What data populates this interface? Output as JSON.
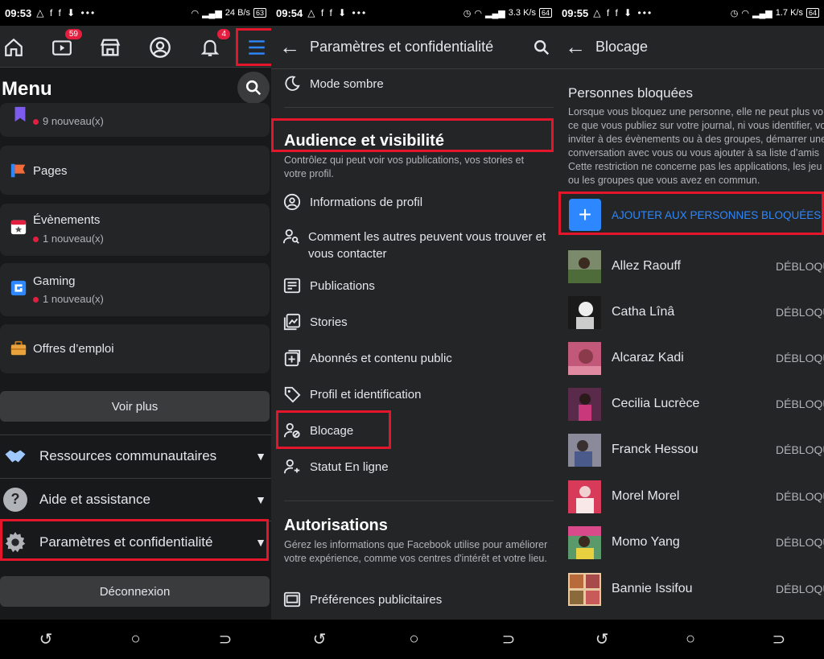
{
  "colors": {
    "highlight": "#e3162c",
    "accent": "#2d88ff",
    "badge": "#e41e3f",
    "bg": "#242526"
  },
  "status_bars": [
    {
      "time": "09:53",
      "left_icons": "△ f f ⬇ •••",
      "right_text": "24 B/s",
      "battery": "63"
    },
    {
      "time": "09:54",
      "left_icons": "△ f f ⬇ •••",
      "right_text": "3.3 K/s",
      "battery": "64"
    },
    {
      "time": "09:55",
      "left_icons": "△ f f ⬇ •••",
      "right_text": "1.7 K/s",
      "battery": "64"
    }
  ],
  "panel1": {
    "top_nav": {
      "watch_badge": "59",
      "notifications_badge": "4"
    },
    "title": "Menu",
    "shortcuts": [
      {
        "name": "",
        "new": "9 nouveau(x)",
        "icon": "bookmark-icon",
        "color": "#7e5bef"
      },
      {
        "name": "Pages",
        "new": "",
        "icon": "flag-icon",
        "color": "#f26b3a"
      },
      {
        "name": "Évènements",
        "new": "1 nouveau(x)",
        "icon": "calendar-icon",
        "color": "#e41e3f"
      },
      {
        "name": "Gaming",
        "new": "1 nouveau(x)",
        "icon": "gaming-icon",
        "color": "#2d88ff"
      },
      {
        "name": "Offres d’emploi",
        "new": "",
        "icon": "briefcase-icon",
        "color": "#e8a33d"
      }
    ],
    "see_more": "Voir plus",
    "sections": [
      {
        "label": "Ressources communautaires",
        "icon": "handshake-icon"
      },
      {
        "label": "Aide et assistance",
        "icon": "help-icon"
      },
      {
        "label": "Paramètres et confidentialité",
        "icon": "gear-icon"
      }
    ],
    "logout": "Déconnexion"
  },
  "panel2": {
    "title": "Paramètres et confidentialité",
    "dark_mode": "Mode sombre",
    "audience": {
      "heading": "Audience et visibilité",
      "description": "Contrôlez qui peut voir vos publications, vos stories et votre profil.",
      "items": [
        "Informations de profil",
        "Comment les autres peuvent vous trouver et vous contacter",
        "Publications",
        "Stories",
        "Abonnés et contenu public",
        "Profil et identification",
        "Blocage",
        "Statut En ligne"
      ]
    },
    "permissions": {
      "heading": "Autorisations",
      "description": "Gérez les informations que Facebook utilise pour améliorer votre expérience, comme vos centres d'intérêt et votre lieu.",
      "items": [
        "Préférences publicitaires"
      ]
    }
  },
  "panel3": {
    "title": "Blocage",
    "section_title": "Personnes bloquées",
    "description_lines": [
      "Lorsque vous bloquez une personne, elle ne peut plus vo",
      "ce que vous publiez sur votre journal, ni vous identifier, vo",
      "inviter à des évènements ou à des groupes, démarrer une",
      "conversation avec vous ou vous ajouter à sa liste d’amis",
      "Cette restriction ne concerne pas les applications, les jeu",
      "ou les groupes que vous avez en commun."
    ],
    "add_blocked": "AJOUTER AUX PERSONNES BLOQUÉES",
    "unblock_label": "DÉBLOQU",
    "people": [
      "Allez Raouff",
      "Catha Lînâ",
      "Alcaraz Kadi",
      "Cecilia Lucrèce",
      "Franck Hessou",
      "Morel Morel",
      "Momo Yang",
      "Bannie Issifou"
    ]
  }
}
